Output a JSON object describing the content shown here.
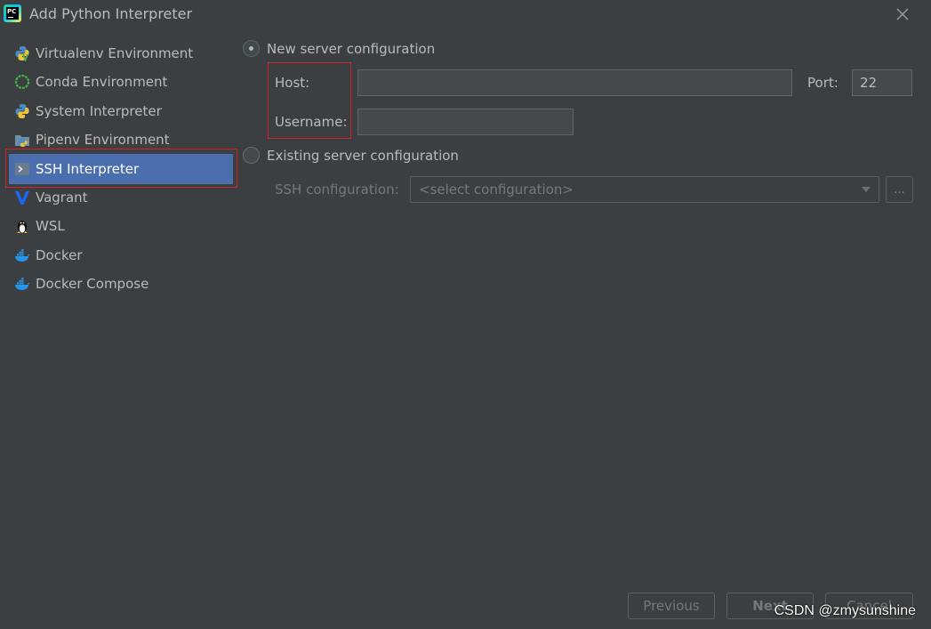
{
  "window": {
    "title": "Add Python Interpreter",
    "logo_text": "PC",
    "logo_icon": "pycharm-logo",
    "close_icon": "close-icon"
  },
  "sidebar": {
    "items": [
      {
        "label": "Virtualenv Environment",
        "icon": "virtualenv-icon"
      },
      {
        "label": "Conda Environment",
        "icon": "conda-icon"
      },
      {
        "label": "System Interpreter",
        "icon": "python-icon"
      },
      {
        "label": "Pipenv Environment",
        "icon": "pipenv-icon"
      },
      {
        "label": "SSH Interpreter",
        "icon": "terminal-icon",
        "selected": true
      },
      {
        "label": "Vagrant",
        "icon": "vagrant-icon"
      },
      {
        "label": "WSL",
        "icon": "linux-icon"
      },
      {
        "label": "Docker",
        "icon": "docker-icon"
      },
      {
        "label": "Docker Compose",
        "icon": "docker-compose-icon"
      }
    ]
  },
  "main": {
    "new_server": {
      "label": "New server configuration",
      "checked": true,
      "host_label": "Host:",
      "host_value": "",
      "port_label": "Port:",
      "port_value": "22",
      "username_label": "Username:",
      "username_value": ""
    },
    "existing_server": {
      "label": "Existing server configuration",
      "checked": false,
      "ssh_config_label": "SSH configuration:",
      "ssh_config_placeholder": "<select configuration>",
      "browse_label": "..."
    }
  },
  "footer": {
    "previous_label": "Previous",
    "next_label": "Next",
    "cancel_label": "Cancel"
  },
  "watermark": "CSDN @zmysunshine",
  "colors": {
    "background": "#3c3f41",
    "selection": "#4b6eaf",
    "highlight": "#d2232a",
    "text": "#bbbbbb"
  }
}
